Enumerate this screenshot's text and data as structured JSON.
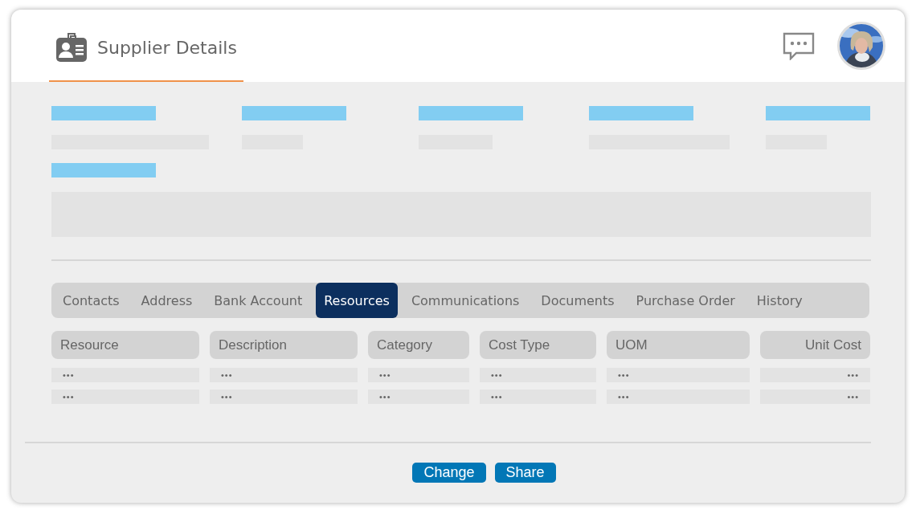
{
  "header": {
    "title": "Supplier Details"
  },
  "tabs": [
    {
      "label": "Contacts",
      "selected": false
    },
    {
      "label": "Address",
      "selected": false
    },
    {
      "label": "Bank Account",
      "selected": false
    },
    {
      "label": "Resources",
      "selected": true
    },
    {
      "label": "Communications",
      "selected": false
    },
    {
      "label": "Documents",
      "selected": false
    },
    {
      "label": "Purchase Order",
      "selected": false
    },
    {
      "label": "History",
      "selected": false
    }
  ],
  "table": {
    "columns": [
      {
        "label": "Resource",
        "kind": "text"
      },
      {
        "label": "Description",
        "kind": "text"
      },
      {
        "label": "Category",
        "kind": "text"
      },
      {
        "label": "Cost Type",
        "kind": "text"
      },
      {
        "label": "UOM",
        "kind": "text"
      },
      {
        "label": "Unit Cost",
        "kind": "amount"
      }
    ],
    "rows": [
      [
        "•••",
        "•••",
        "•••",
        "•••",
        "•••",
        "•••"
      ],
      [
        "•••",
        "•••",
        "•••",
        "•••",
        "•••",
        "•••"
      ]
    ]
  },
  "buttons": [
    "Change",
    "Share"
  ]
}
